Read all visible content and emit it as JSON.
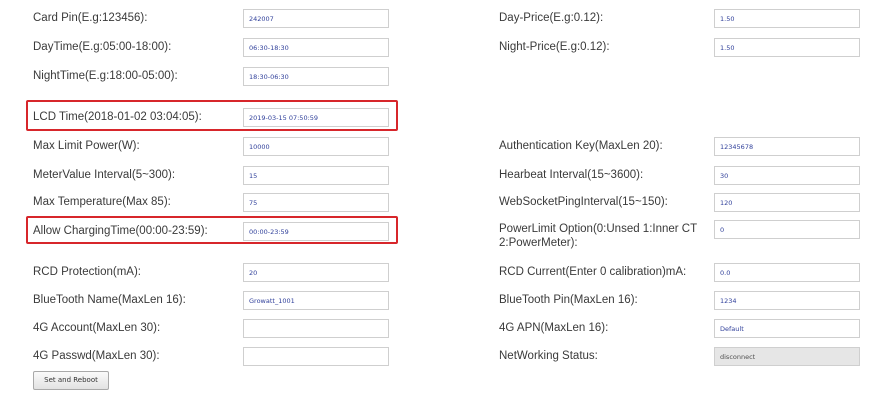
{
  "left_fields": [
    {
      "label": "Card Pin(E.g:123456):",
      "value": "242007"
    },
    {
      "label": "DayTime(E.g:05:00-18:00):",
      "value": "06:30-18:30"
    },
    {
      "label": "NightTime(E.g:18:00-05:00):",
      "value": "18:30-06:30"
    },
    {
      "label": "LCD Time(2018-01-02 03:04:05):",
      "value": "2019-03-15 07:50:59"
    },
    {
      "label": "Max Limit Power(W):",
      "value": "10000"
    },
    {
      "label": "MeterValue Interval(5~300):",
      "value": "15"
    },
    {
      "label": "Max Temperature(Max 85):",
      "value": "75"
    },
    {
      "label": "Allow ChargingTime(00:00-23:59):",
      "value": "00:00-23:59"
    },
    {
      "label": "RCD Protection(mA):",
      "value": "20"
    },
    {
      "label": "BlueTooth Name(MaxLen 16):",
      "value": "Growatt_1001"
    },
    {
      "label": "4G Account(MaxLen 30):",
      "value": ""
    },
    {
      "label": "4G Passwd(MaxLen 30):",
      "value": ""
    }
  ],
  "right_fields": [
    {
      "label": "Day-Price(E.g:0.12):",
      "value": "1.50"
    },
    {
      "label": "Night-Price(E.g:0.12):",
      "value": "1.50"
    },
    {
      "label": "Authentication Key(MaxLen 20):",
      "value": "12345678"
    },
    {
      "label": "Hearbeat Interval(15~3600):",
      "value": "30"
    },
    {
      "label": "WebSocketPingInterval(15~150):",
      "value": "120"
    },
    {
      "label": "PowerLimit Option(0:Unsed 1:Inner CT 2:PowerMeter):",
      "value": "0"
    },
    {
      "label": "RCD Current(Enter 0 calibration)mA:",
      "value": "0.0"
    },
    {
      "label": "BlueTooth Pin(MaxLen 16):",
      "value": "1234"
    },
    {
      "label": "4G APN(MaxLen 16):",
      "value": "Default"
    },
    {
      "label": "NetWorking Status:",
      "value": "disconnect"
    }
  ],
  "buttons": {
    "set_and_reboot": "Set and Reboot"
  },
  "highlight_color": "#d7262b"
}
